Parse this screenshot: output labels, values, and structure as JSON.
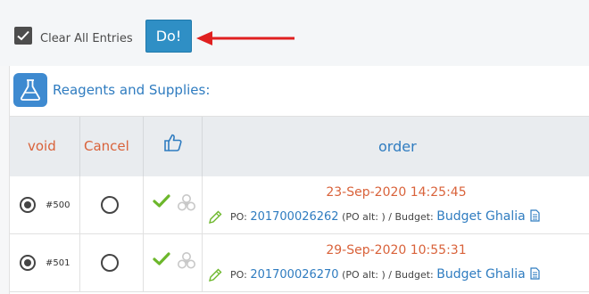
{
  "toolbar": {
    "clear_all_label": "Clear All Entries",
    "clear_all_checked": true,
    "do_button": "Do!"
  },
  "section": {
    "icon": "flask-icon",
    "title": "Reagents and Supplies:"
  },
  "table": {
    "columns": [
      "void",
      "Cancel",
      "thumbs-up-icon",
      "order"
    ],
    "rows": [
      {
        "void_selected": true,
        "number": "#500",
        "date": "23-Sep-2020 14:25:45",
        "po_label": "PO:",
        "po_number": "201700026262",
        "po_alt": "(PO alt: )",
        "budget_label": "/ Budget:",
        "budget": "Budget Ghalia"
      },
      {
        "void_selected": true,
        "number": "#501",
        "date": "29-Sep-2020 10:55:31",
        "po_label": "PO:",
        "po_number": "201700026270",
        "po_alt": "(PO alt: )",
        "budget_label": "/ Budget:",
        "budget": "Budget Ghalia"
      }
    ]
  },
  "colors": {
    "accent_blue": "#2f8fc5",
    "header_orange": "#d9623a",
    "check_green": "#6cb72b",
    "arrow_red": "#e02020"
  }
}
